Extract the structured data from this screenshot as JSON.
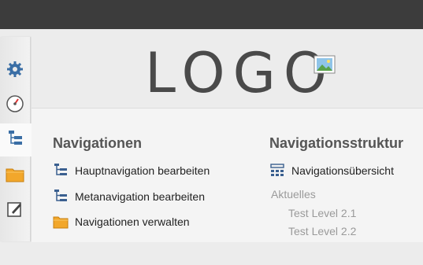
{
  "header": {
    "logo_text": "LOGO"
  },
  "sidebar": {
    "items": [
      {
        "icon": "gear-icon"
      },
      {
        "icon": "speedometer-icon"
      },
      {
        "icon": "tree-structure-icon"
      },
      {
        "icon": "folder-icon"
      },
      {
        "icon": "edit-icon"
      }
    ]
  },
  "navigations": {
    "title": "Navigationen",
    "items": [
      {
        "label": "Hauptnavigation bearbeiten",
        "icon": "tree-list-icon"
      },
      {
        "label": "Metanavigation bearbeiten",
        "icon": "tree-list-icon"
      },
      {
        "label": "Navigationen verwalten",
        "icon": "folder-icon"
      }
    ]
  },
  "structure": {
    "title": "Navigationsstruktur",
    "overview_label": "Navigationsübersicht",
    "tree": {
      "parent": "Aktuelles",
      "children": [
        "Test Level 2.1",
        "Test Level 2.2"
      ]
    }
  },
  "colors": {
    "topbar": "#3c3c3c",
    "icon_blue": "#3a6ea5",
    "folder_orange": "#f2a72b"
  }
}
